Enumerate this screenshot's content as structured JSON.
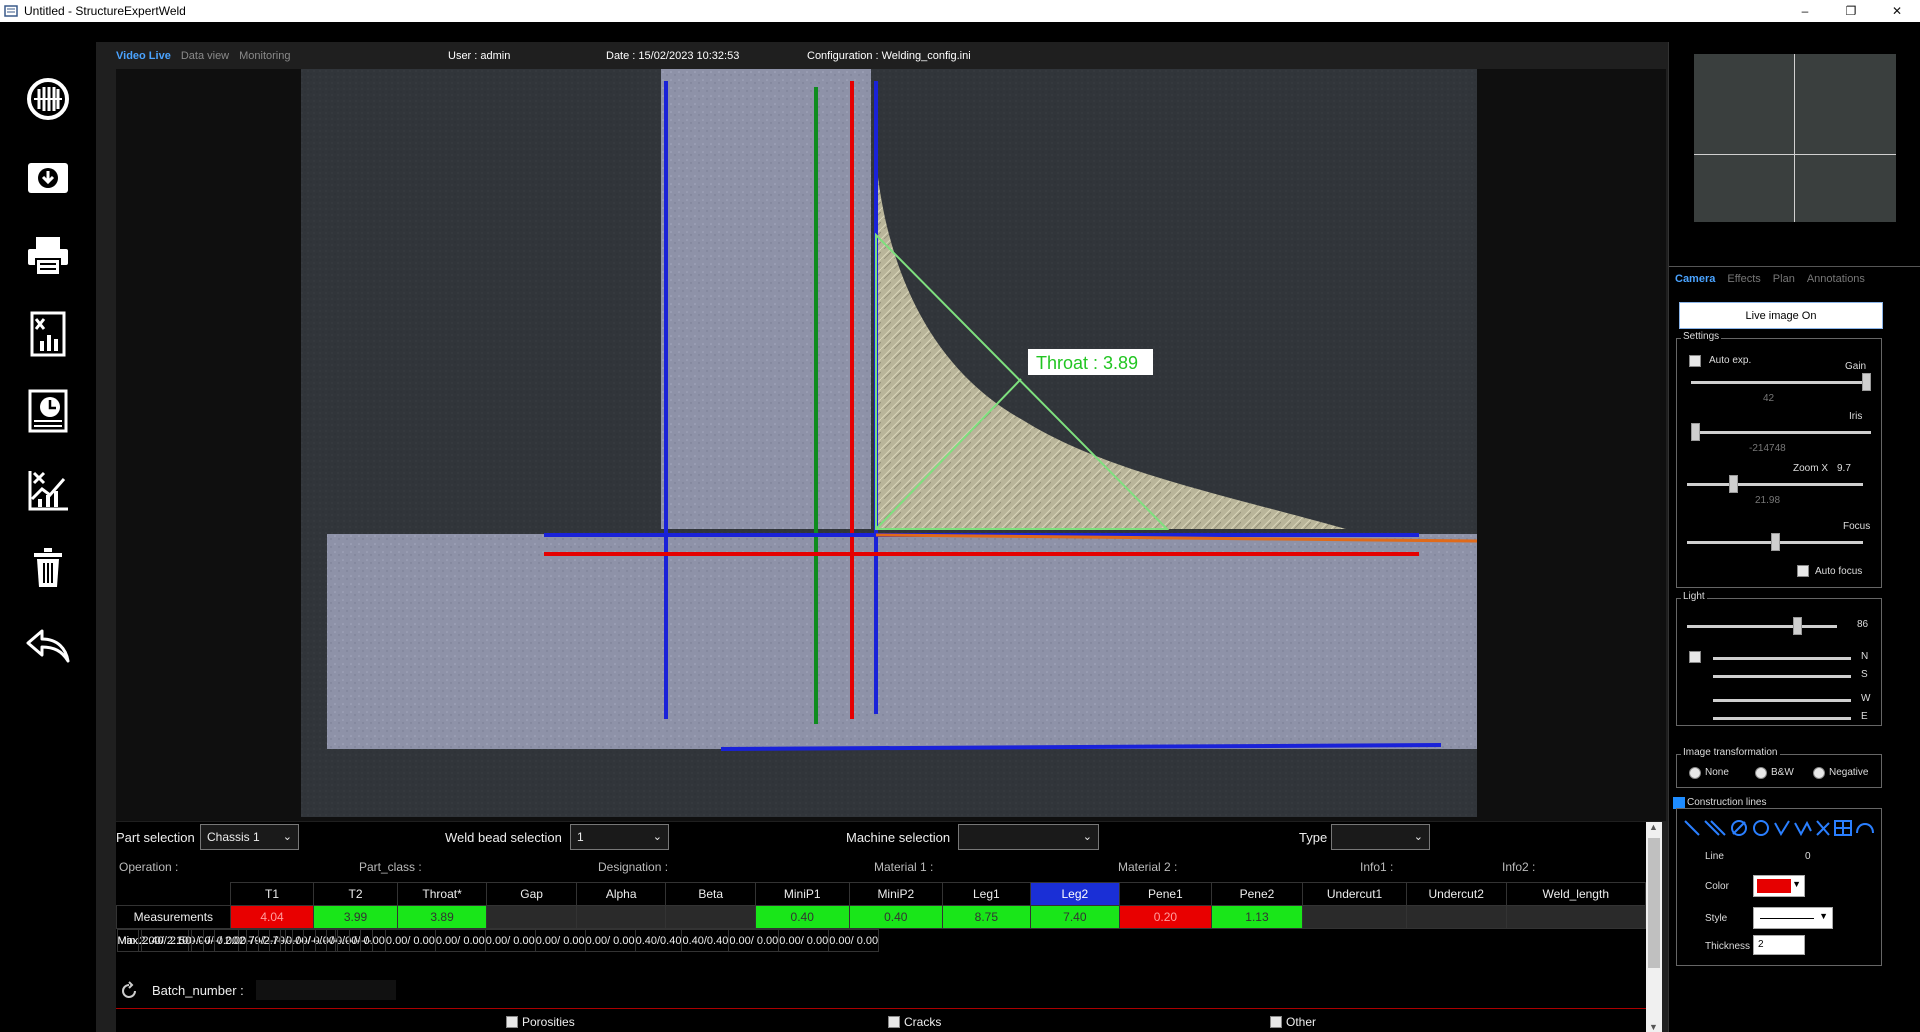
{
  "window": {
    "title": "Untitled - StructureExpertWeld",
    "buttons": {
      "minimize": "–",
      "maximize": "❐",
      "close": "✕"
    }
  },
  "toolbar": {
    "items": [
      {
        "name": "capture-icon"
      },
      {
        "name": "import-icon"
      },
      {
        "name": "print-icon"
      },
      {
        "name": "excel-report-icon"
      },
      {
        "name": "history-report-icon"
      },
      {
        "name": "statistics-icon"
      },
      {
        "name": "delete-icon"
      },
      {
        "name": "undo-icon"
      }
    ]
  },
  "info": {
    "tabs": [
      {
        "label": "Video Live",
        "active": true
      },
      {
        "label": "Data view",
        "active": false
      },
      {
        "label": "Monitoring",
        "active": false
      }
    ],
    "user": "User : admin",
    "date": "Date : 15/02/2023 10:32:53",
    "configuration": "Configuration : Welding_config.ini"
  },
  "image": {
    "throat_label": "Throat :  3.89"
  },
  "right_panel": {
    "tabs": [
      {
        "label": "Camera",
        "active": true
      },
      {
        "label": "Effects",
        "active": false
      },
      {
        "label": "Plan",
        "active": false
      },
      {
        "label": "Annotations",
        "active": false
      }
    ],
    "live_button": "Live image On",
    "settings": {
      "legend": "Settings",
      "auto_exp": "Auto exp.",
      "gain_label": "Gain",
      "gain_value": "42",
      "gain_level": 1.0,
      "iris_label": "Iris",
      "iris_value": "-214748",
      "iris_level": 0.0,
      "zoom_label": "Zoom X",
      "zoom_value": "9.7",
      "zoom_sub": "21.98",
      "zoom_level": 0.25,
      "focus_label": "Focus",
      "focus_level": 0.5,
      "auto_focus": "Auto focus"
    },
    "light": {
      "legend": "Light",
      "value": "86",
      "level": 0.75,
      "directions": [
        "N",
        "S",
        "W",
        "E"
      ]
    },
    "image_transformation": {
      "legend": "Image transformation",
      "options": [
        "None",
        "B&W",
        "Negative"
      ]
    },
    "construction_lines": {
      "legend": "Construction lines",
      "checked": true,
      "line_label": "Line",
      "line_value": "0",
      "color_label": "Color",
      "color_value": "#e60000",
      "style_label": "Style",
      "thickness_label": "Thickness",
      "thickness_value": "2"
    }
  },
  "bottom": {
    "part_selection_label": "Part selection",
    "part_selection_value": "Chassis 1",
    "weld_bead_label": "Weld bead selection",
    "weld_bead_value": "1",
    "machine_label": "Machine selection",
    "machine_value": "",
    "type_label": "Type",
    "type_value": "",
    "operation": "Operation :",
    "part_class": "Part_class :",
    "designation": "Designation :",
    "material1": "Material 1 :",
    "material2": "Material 2 :",
    "info1": "Info1 :",
    "info2": "Info2 :",
    "columns": [
      "T1",
      "T2",
      "Throat*",
      "Gap",
      "Alpha",
      "Beta",
      "MiniP1",
      "MiniP2",
      "Leg1",
      "Leg2",
      "Pene1",
      "Pene2",
      "Undercut1",
      "Undercut2",
      "Weld_length"
    ],
    "rows": [
      {
        "label": "Measurements",
        "values": [
          "4.04",
          "3.99",
          "3.89",
          "",
          "",
          "",
          "0.40",
          "0.40",
          "8.75",
          "7.40",
          "0.20",
          "1.13",
          "",
          "",
          ""
        ],
        "status": [
          "red",
          "green",
          "green",
          "",
          "",
          "",
          "green",
          "green",
          "green",
          "green",
          "red",
          "green",
          "",
          "",
          ""
        ]
      },
      {
        "label": "Min.",
        "values": [
          "2.00/ 2.10",
          "0.00/ 0.00",
          "2.79/2.79",
          "0.00/ 0.00",
          "0.00/ 0.00",
          "0.00/ 0.00",
          "0.00/ 0.00",
          "0.00/ 0.00",
          "0.00/ 0.00",
          "0.00/ 0.00",
          "0.40/0.40",
          "0.40/0.40",
          "0.00/ 0.00",
          "0.00/ 0.00",
          "0.00/ 0.00"
        ]
      },
      {
        "label": "Max.",
        "values": [
          "2.40/ 2.50",
          "-/-",
          "-/-",
          "-/ 2.00",
          "-/-",
          "-/-",
          "-/-",
          "-/-",
          "-/-",
          "-/-",
          "-/-",
          "-/-",
          "-/-",
          "-/-",
          "-/-"
        ]
      }
    ],
    "batch_label": "Batch_number :",
    "defects": [
      "Porosities",
      "Cracks",
      "Other"
    ]
  }
}
